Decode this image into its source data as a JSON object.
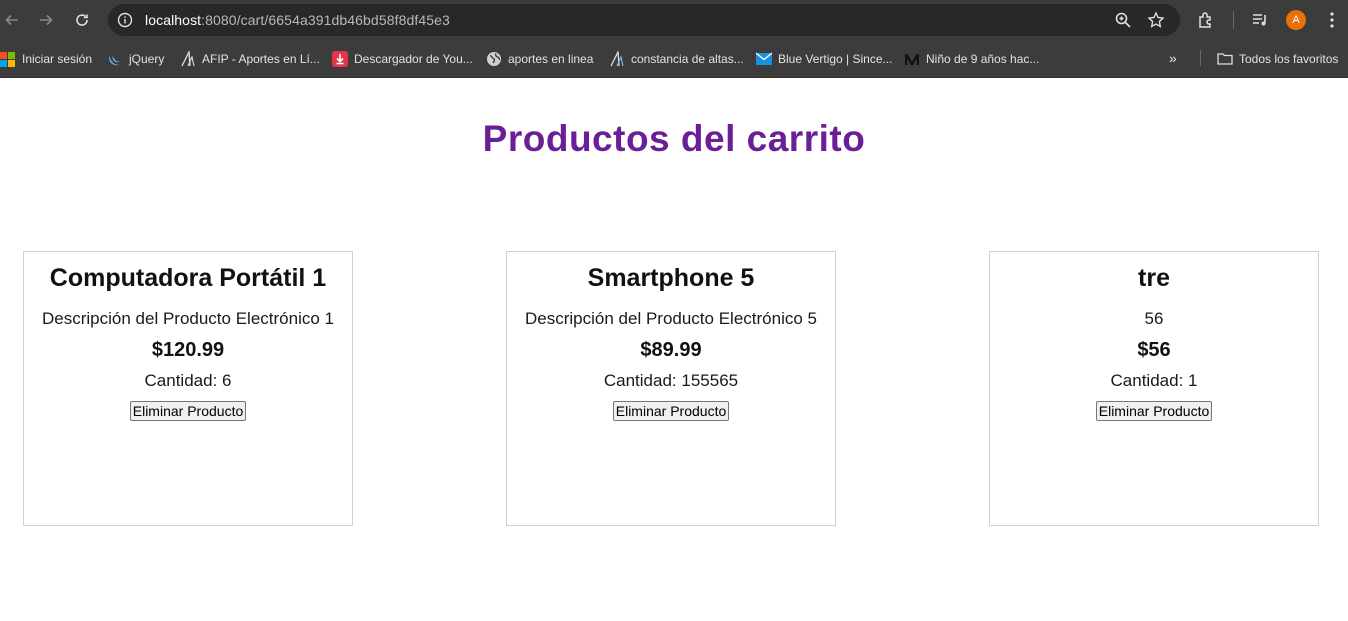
{
  "browser": {
    "url_host": "localhost",
    "url_path": ":8080/cart/6654a391db46bd58f8df45e3",
    "avatar_letter": "A",
    "bookmarks": [
      {
        "label": "Iniciar sesión",
        "icon": "microsoft-icon"
      },
      {
        "label": "jQuery",
        "icon": "jquery-icon"
      },
      {
        "label": "AFIP - Aportes en Lí...",
        "icon": "afip-icon"
      },
      {
        "label": "Descargador de You...",
        "icon": "download-icon"
      },
      {
        "label": "aportes en linea",
        "icon": "globe-icon"
      },
      {
        "label": "constancia de altas...",
        "icon": "afip-icon"
      },
      {
        "label": "Blue Vertigo | Since...",
        "icon": "mail-icon"
      },
      {
        "label": "Niño de 9 años hac...",
        "icon": "medium-icon"
      }
    ],
    "overflow_label": "»",
    "all_bookmarks_label": "Todos los favoritos"
  },
  "page": {
    "title": "Productos del carrito",
    "title_color": "#6b1f96",
    "products": [
      {
        "name": "Computadora Portátil 1",
        "description": "Descripción del Producto Electrónico 1",
        "price": "$120.99",
        "quantity": "Cantidad: 6",
        "remove_label": "Eliminar Producto"
      },
      {
        "name": "Smartphone 5",
        "description": "Descripción del Producto Electrónico 5",
        "price": "$89.99",
        "quantity": "Cantidad: 155565",
        "remove_label": "Eliminar Producto"
      },
      {
        "name": "tre",
        "description": "56",
        "price": "$56",
        "quantity": "Cantidad: 1",
        "remove_label": "Eliminar Producto"
      }
    ]
  }
}
